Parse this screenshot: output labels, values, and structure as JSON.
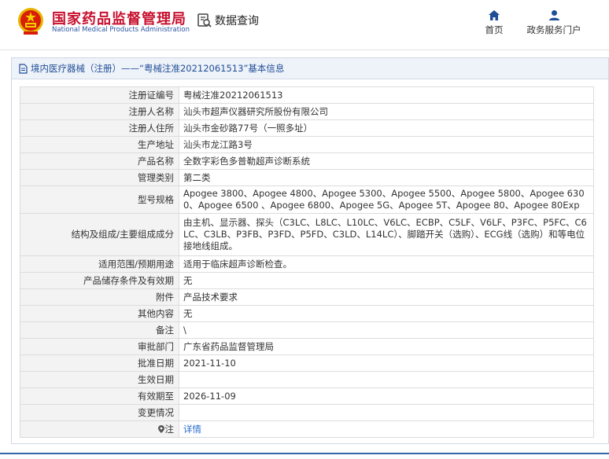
{
  "header": {
    "org_name_cn": "国家药品监督管理局",
    "org_name_en": "National Medical Products Administration",
    "query_label": "数据查询",
    "nav": [
      {
        "label": "首页",
        "icon": "home-icon"
      },
      {
        "label": "政务服务门户",
        "icon": "user-icon"
      }
    ],
    "brand_color": "#c8102e",
    "accent_color": "#2a55a5"
  },
  "panel": {
    "title": "境内医疗器械（注册）——“粤械注准20212061513”基本信息",
    "rows": [
      {
        "key": "注册证编号",
        "value": "粤械注准20212061513"
      },
      {
        "key": "注册人名称",
        "value": "汕头市超声仪器研究所股份有限公司"
      },
      {
        "key": "注册人住所",
        "value": "汕头市金砂路77号（一照多址）"
      },
      {
        "key": "生产地址",
        "value": "汕头市龙江路3号"
      },
      {
        "key": "产品名称",
        "value": "全数字彩色多普勒超声诊断系统"
      },
      {
        "key": "管理类别",
        "value": "第二类"
      },
      {
        "key": "型号规格",
        "value": "Apogee 3800、Apogee 4800、Apogee 5300、Apogee 5500、Apogee 5800、Apogee 6300、Apogee 6500 、Apogee 6800、Apogee 5G、Apogee 5T、Apogee 80、Apogee 80Exp"
      },
      {
        "key": "结构及组成/主要组成成分",
        "value": "由主机、显示器、探头（C3LC、L8LC、L10LC、V6LC、ECBP、C5LF、V6LF、P3FC、P5FC、C6LC、C3LB、P3FB、P3FD、P5FD、C3LD、L14LC）、脚踏开关（选购）、ECG线（选购）和等电位接地线组成。"
      },
      {
        "key": "适用范围/预期用途",
        "value": "适用于临床超声诊断检查。"
      },
      {
        "key": "产品储存条件及有效期",
        "value": "无"
      },
      {
        "key": "附件",
        "value": "产品技术要求"
      },
      {
        "key": "其他内容",
        "value": "无"
      },
      {
        "key": "备注",
        "value": "\\"
      },
      {
        "key": "审批部门",
        "value": "广东省药品监督管理局"
      },
      {
        "key": "批准日期",
        "value": "2021-11-10"
      },
      {
        "key": "生效日期",
        "value": ""
      },
      {
        "key": "有效期至",
        "value": "2026-11-09"
      },
      {
        "key": "变更情况",
        "value": ""
      }
    ],
    "note_row": {
      "key": "注",
      "value": "详情"
    }
  }
}
